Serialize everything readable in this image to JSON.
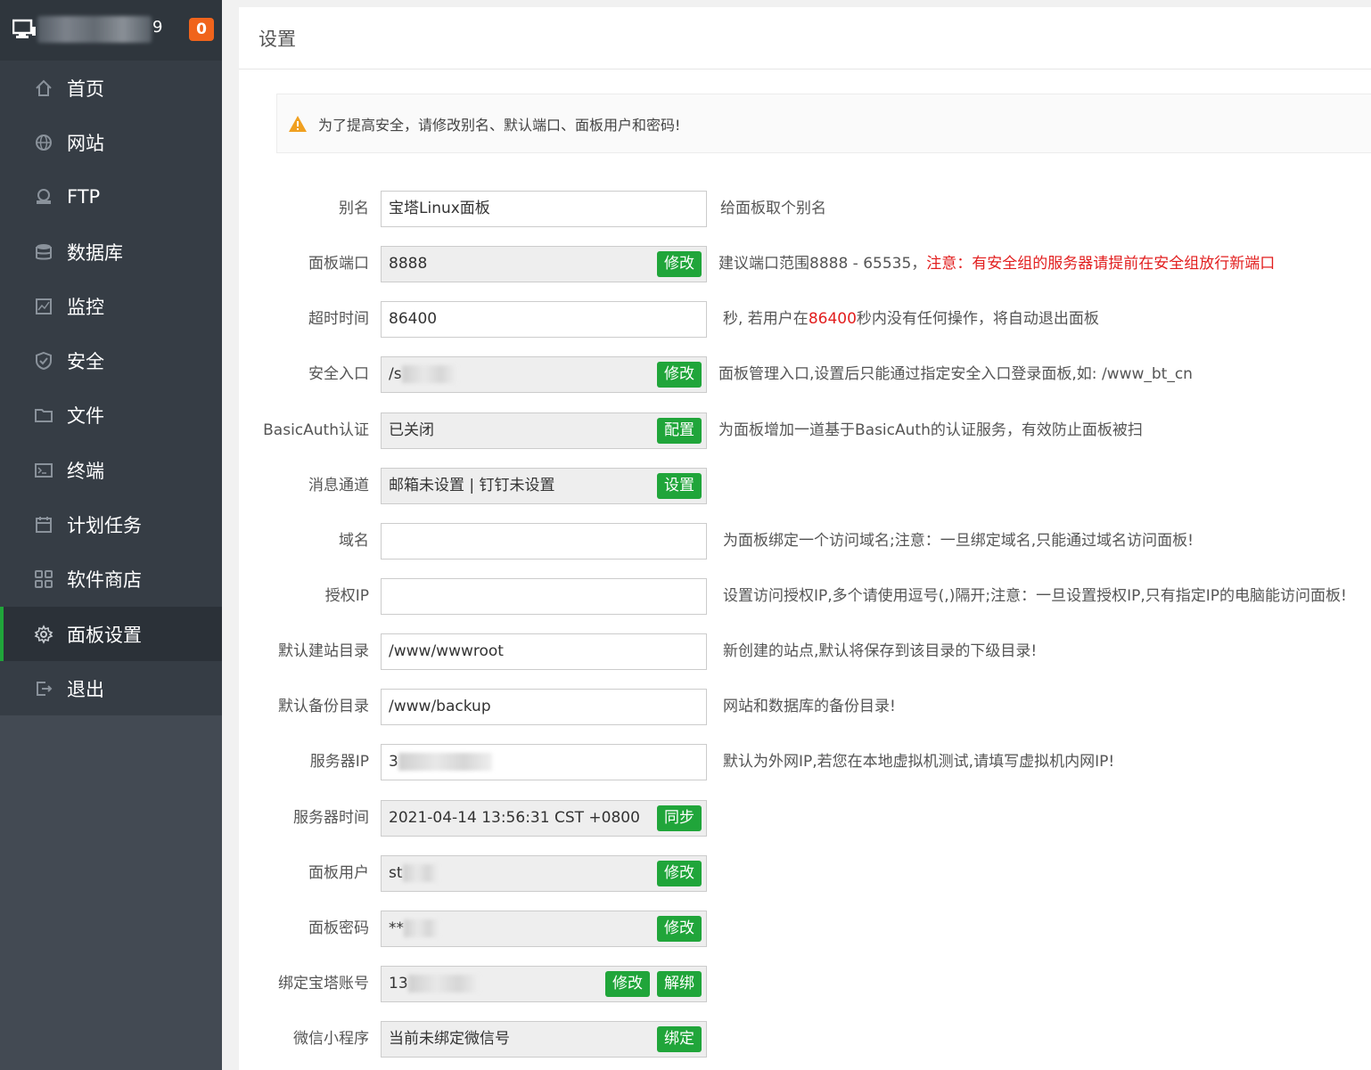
{
  "sidebar": {
    "host_suffix": "9",
    "message_count": "0",
    "items": [
      {
        "label": "首页",
        "icon": "home-icon"
      },
      {
        "label": "网站",
        "icon": "globe-icon"
      },
      {
        "label": "FTP",
        "icon": "ftp-icon"
      },
      {
        "label": "数据库",
        "icon": "database-icon"
      },
      {
        "label": "监控",
        "icon": "monitor-chart-icon"
      },
      {
        "label": "安全",
        "icon": "shield-icon"
      },
      {
        "label": "文件",
        "icon": "folder-icon"
      },
      {
        "label": "终端",
        "icon": "terminal-icon"
      },
      {
        "label": "计划任务",
        "icon": "calendar-icon"
      },
      {
        "label": "软件商店",
        "icon": "apps-grid-icon"
      },
      {
        "label": "面板设置",
        "icon": "gear-icon"
      },
      {
        "label": "退出",
        "icon": "logout-icon"
      }
    ]
  },
  "page": {
    "title": "设置",
    "alert": "为了提高安全，请修改别名、默认端口、面板用户和密码!"
  },
  "form": {
    "alias": {
      "label": "别名",
      "value": "宝塔Linux面板",
      "hint": "给面板取个别名"
    },
    "port": {
      "label": "面板端口",
      "value": "8888",
      "button": "修改",
      "hint": "建议端口范围8888 - 65535，",
      "hint_red": "注意：有安全组的服务器请提前在安全组放行新端口"
    },
    "timeout": {
      "label": "超时时间",
      "value": "86400",
      "hint_pre": "秒, 若用户在",
      "hint_red": "86400",
      "hint_post": "秒内没有任何操作，将自动退出面板"
    },
    "entry": {
      "label": "安全入口",
      "value": "/s",
      "button": "修改",
      "hint": "面板管理入口,设置后只能通过指定安全入口登录面板,如: /www_bt_cn"
    },
    "basicauth": {
      "label": "BasicAuth认证",
      "value": "已关闭",
      "button": "配置",
      "hint": "为面板增加一道基于BasicAuth的认证服务，有效防止面板被扫"
    },
    "channel": {
      "label": "消息通道",
      "value": "邮箱未设置 | 钉钉未设置",
      "button": "设置"
    },
    "domain": {
      "label": "域名",
      "value": "",
      "hint": "为面板绑定一个访问域名;注意：一旦绑定域名,只能通过域名访问面板!"
    },
    "auth_ip": {
      "label": "授权IP",
      "value": "",
      "hint": "设置访问授权IP,多个请使用逗号(,)隔开;注意：一旦设置授权IP,只有指定IP的电脑能访问面板!"
    },
    "site_dir": {
      "label": "默认建站目录",
      "value": "/www/wwwroot",
      "hint": "新创建的站点,默认将保存到该目录的下级目录!"
    },
    "backup_dir": {
      "label": "默认备份目录",
      "value": "/www/backup",
      "hint": "网站和数据库的备份目录!"
    },
    "server_ip": {
      "label": "服务器IP",
      "value": "3",
      "hint": "默认为外网IP,若您在本地虚拟机测试,请填写虚拟机内网IP!"
    },
    "server_time": {
      "label": "服务器时间",
      "value": "2021-04-14 13:56:31 CST +0800",
      "button": "同步"
    },
    "user": {
      "label": "面板用户",
      "value": "st",
      "button": "修改"
    },
    "password": {
      "label": "面板密码",
      "value": "**",
      "button": "修改"
    },
    "bt_account": {
      "label": "绑定宝塔账号",
      "value": "13",
      "button": "修改",
      "button2": "解绑"
    },
    "wechat": {
      "label": "微信小程序",
      "value": "当前未绑定微信号",
      "button": "绑定"
    }
  },
  "colors": {
    "sidebar_bg": "#3c444d",
    "accent_green": "#20a53a",
    "badge_orange": "#f0641c",
    "warning_red": "#e21e1e"
  }
}
